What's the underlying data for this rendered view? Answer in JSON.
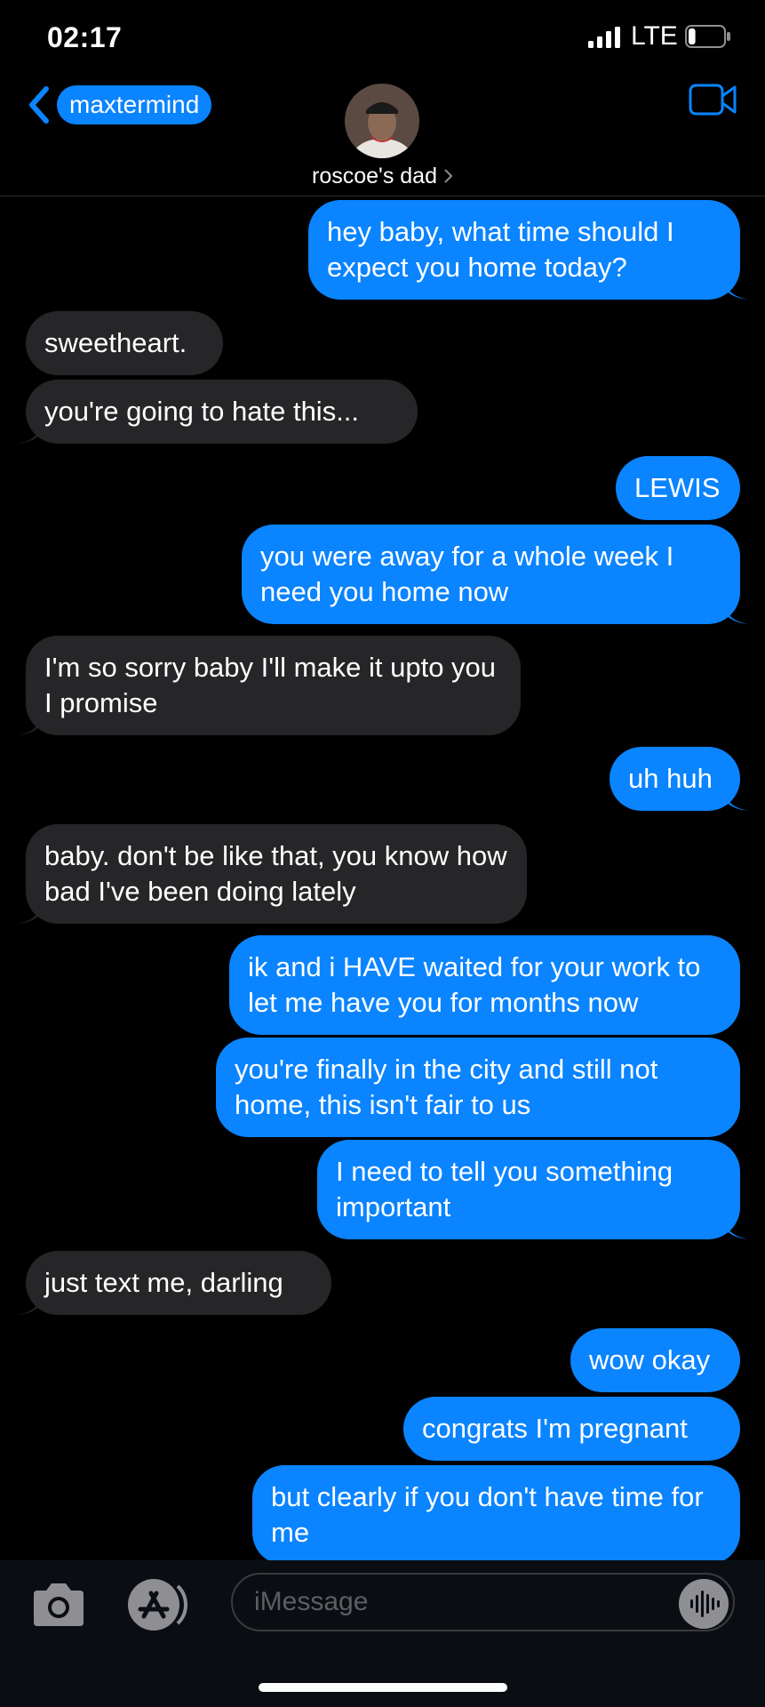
{
  "status_bar": {
    "time": "02:17",
    "carrier": "LTE",
    "battery_level": 0.2
  },
  "header": {
    "back_label": "maxtermind",
    "contact_name": "roscoe's dad"
  },
  "messages": [
    {
      "from": "me",
      "text": "hey baby, what time should I expect you home today?"
    },
    {
      "from": "them",
      "text": "sweetheart."
    },
    {
      "from": "them",
      "text": "you're going to hate this..."
    },
    {
      "from": "me",
      "text": "LEWIS"
    },
    {
      "from": "me",
      "text": "you were away for a whole week I need you home now"
    },
    {
      "from": "them",
      "text": "I'm so sorry baby I'll make it upto you I promise"
    },
    {
      "from": "me",
      "text": "uh huh"
    },
    {
      "from": "them",
      "text": "baby. don't be like that, you know how bad I've been doing lately"
    },
    {
      "from": "me",
      "text": "ik and i HAVE waited for your work to let me have you for months now"
    },
    {
      "from": "me",
      "text": "you're finally in the city and still not home, this isn't fair to us"
    },
    {
      "from": "me",
      "text": "I need to tell you something important"
    },
    {
      "from": "them",
      "text": "just text me, darling"
    },
    {
      "from": "me",
      "text": "wow okay"
    },
    {
      "from": "me",
      "text": "congrats I'm pregnant"
    },
    {
      "from": "me",
      "text": "but clearly if you don't have time for me"
    }
  ],
  "input": {
    "placeholder": "iMessage"
  },
  "colors": {
    "sent_bubble": "#0a84ff",
    "received_bubble": "#262628",
    "background": "#000000"
  },
  "icons": [
    "signal-icon",
    "battery-icon",
    "back-chevron-icon",
    "video-call-icon",
    "camera-icon",
    "app-store-icon",
    "audio-message-icon"
  ]
}
